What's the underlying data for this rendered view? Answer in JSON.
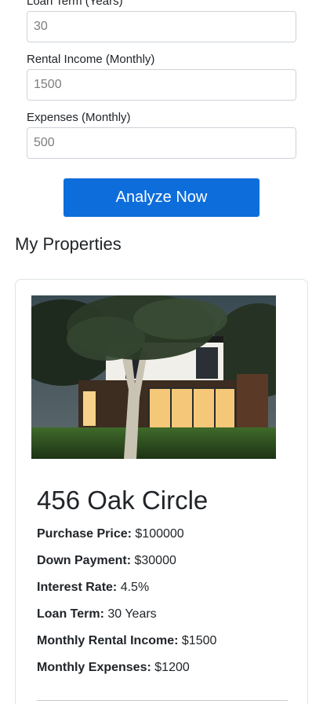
{
  "form": {
    "loan_term": {
      "label": "Loan Term (Years)",
      "placeholder": "30"
    },
    "rental_income": {
      "label": "Rental Income (Monthly)",
      "placeholder": "1500"
    },
    "expenses": {
      "label": "Expenses (Monthly)",
      "placeholder": "500"
    },
    "analyze_button": "Analyze Now"
  },
  "properties": {
    "section_title": "My Properties",
    "items": [
      {
        "image_icon": "house-photo-icon",
        "name": "456 Oak Circle",
        "details": [
          {
            "label": "Purchase Price:",
            "value": "$100000"
          },
          {
            "label": "Down Payment:",
            "value": "$30000"
          },
          {
            "label": "Interest Rate:",
            "value": "4.5%"
          },
          {
            "label": "Loan Term:",
            "value": "30 Years"
          },
          {
            "label": "Monthly Rental Income:",
            "value": "$1500"
          },
          {
            "label": "Monthly Expenses:",
            "value": "$1200"
          }
        ]
      }
    ]
  },
  "colors": {
    "primary_button": "#0d6ddb",
    "text": "#212529",
    "border": "#ced4da"
  }
}
